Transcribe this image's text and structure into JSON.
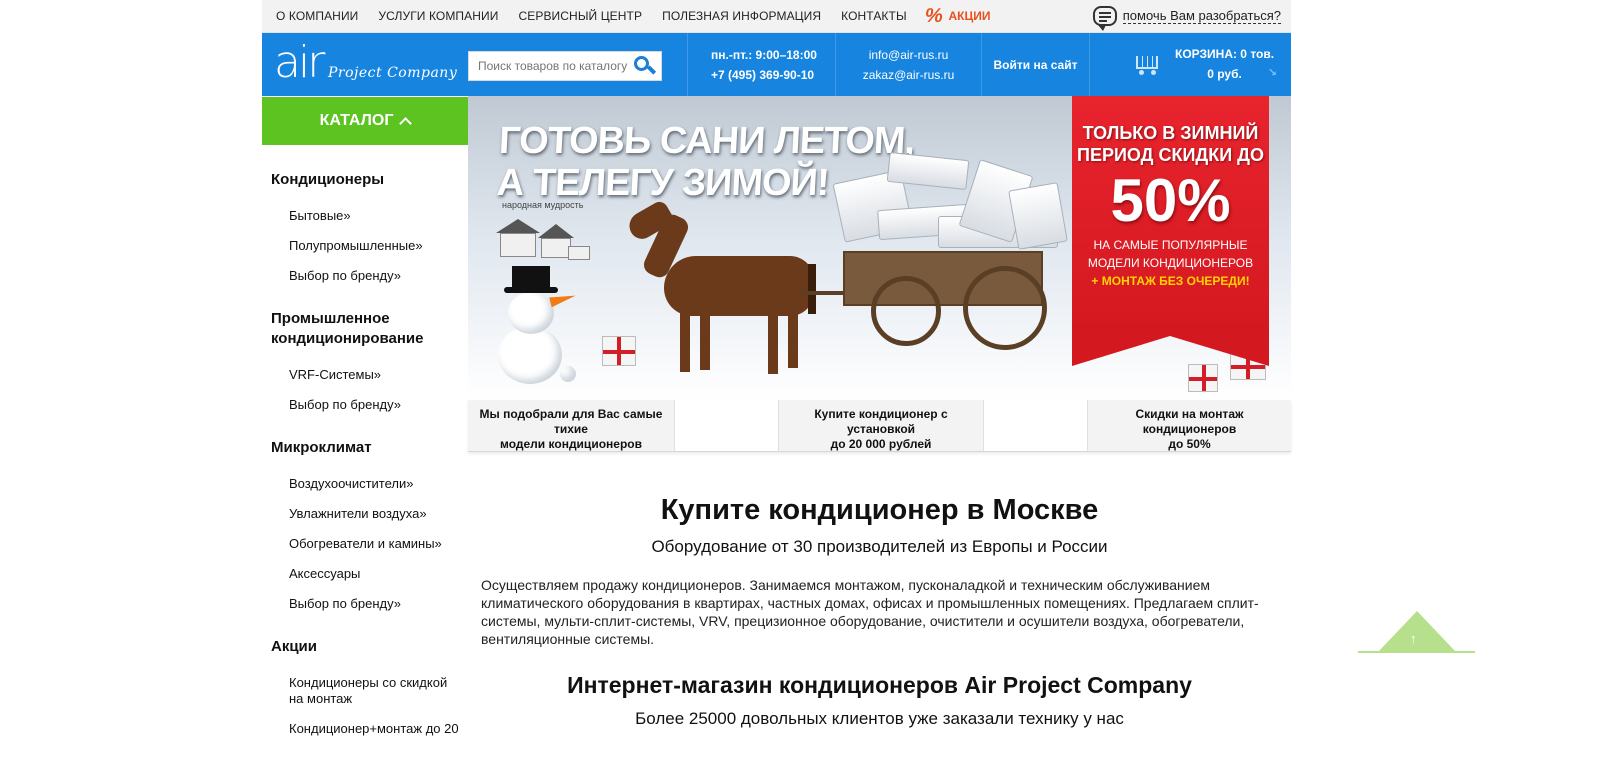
{
  "topnav": {
    "items": [
      "О КОМПАНИИ",
      "УСЛУГИ КОМПАНИИ",
      "СЕРВИСНЫЙ ЦЕНТР",
      "ПОЛЕЗНАЯ ИНФОРМАЦИЯ",
      "КОНТАКТЫ"
    ],
    "promo_icon": "%",
    "promo_label": "АКЦИИ",
    "help_text": "помочь Вам разобраться?"
  },
  "header": {
    "logo_main": "air",
    "logo_sub": "Project Company",
    "search_placeholder": "Поиск товаров по каталогу",
    "hours": "пн.-пт.: 9:00–18:00",
    "phone": "+7 (495) 369-90-10",
    "email_info": "info@air-rus.ru",
    "email_order": "zakaz@air-rus.ru",
    "login": "Войти на сайт",
    "cart_line1": "КОРЗИНА: 0 тов.",
    "cart_line2": "0 руб.",
    "cart_arrow": "↘"
  },
  "sidebar": {
    "catalog_label": "КАТАЛОГ",
    "groups": [
      {
        "title": "Кондиционеры",
        "items": [
          "Бытовые»",
          "Полупромышленные»",
          "Выбор по бренду»"
        ]
      },
      {
        "title": "Промышленное кондиционирование",
        "items": [
          "VRF-Системы»",
          "Выбор по бренду»"
        ]
      },
      {
        "title": "Микроклимат",
        "items": [
          "Воздухоочистители»",
          "Увлажнители воздуха»",
          "Обогреватели и камины»",
          "Аксессуары",
          "Выбор по бренду»"
        ]
      },
      {
        "title": "Акции",
        "items": [
          "Кондиционеры со скидкой на монтаж",
          "Кондиционер+монтаж до 20"
        ]
      }
    ]
  },
  "banner": {
    "headline_1": "ГОТОВЬ САНИ ЛЕТОМ,",
    "headline_2": "А ТЕЛЕГУ ЗИМОЙ!",
    "folk": "народная мудрость",
    "promo_l1": "ТОЛЬКО В ЗИМНИЙ",
    "promo_l2": "ПЕРИОД СКИДКИ ДО",
    "promo_pct": "50%",
    "promo_l3": "НА САМЫЕ ПОПУЛЯРНЫЕ",
    "promo_l4": "МОДЕЛИ КОНДИЦИОНЕРОВ",
    "promo_l5": "+ МОНТАЖ БЕЗ ОЧЕРЕДИ!"
  },
  "tabs": [
    {
      "label_1": "Мы подобрали для Вас самые тихие",
      "label_2": "модели кондиционеров"
    },
    {
      "label_1": "",
      "label_2": ""
    },
    {
      "label_1": "Купите кондиционер с установкой",
      "label_2": "до 20 000 рублей"
    },
    {
      "label_1": "",
      "label_2": ""
    },
    {
      "label_1": "Скидки на монтаж кондиционеров",
      "label_2": "до 50%"
    }
  ],
  "main": {
    "title": "Купите кондиционер в Москве",
    "subtitle": "Оборудование от 30 производителей из Европы и России",
    "paragraph": "Осуществляем продажу кондиционеров. Занимаемся монтажом, пусконаладкой и техническим обслуживанием климатического оборудования в квартирах, частных домах, офисах и промышленных помещениях. Предлагаем сплит-системы, мульти-сплит-системы, VRV, прецизионное оборудование, очистители и осушители воздуха, обогреватели, вентиляционные системы.",
    "title2": "Интернет-магазин кондиционеров Air Project Company",
    "subtitle2": "Более 25000 довольных клиентов уже заказали технику у нас"
  },
  "totop_icon": "↑",
  "colors": {
    "blue": "#1785e0",
    "green": "#5cc320",
    "red": "#e8242d",
    "orange": "#e8501e"
  }
}
